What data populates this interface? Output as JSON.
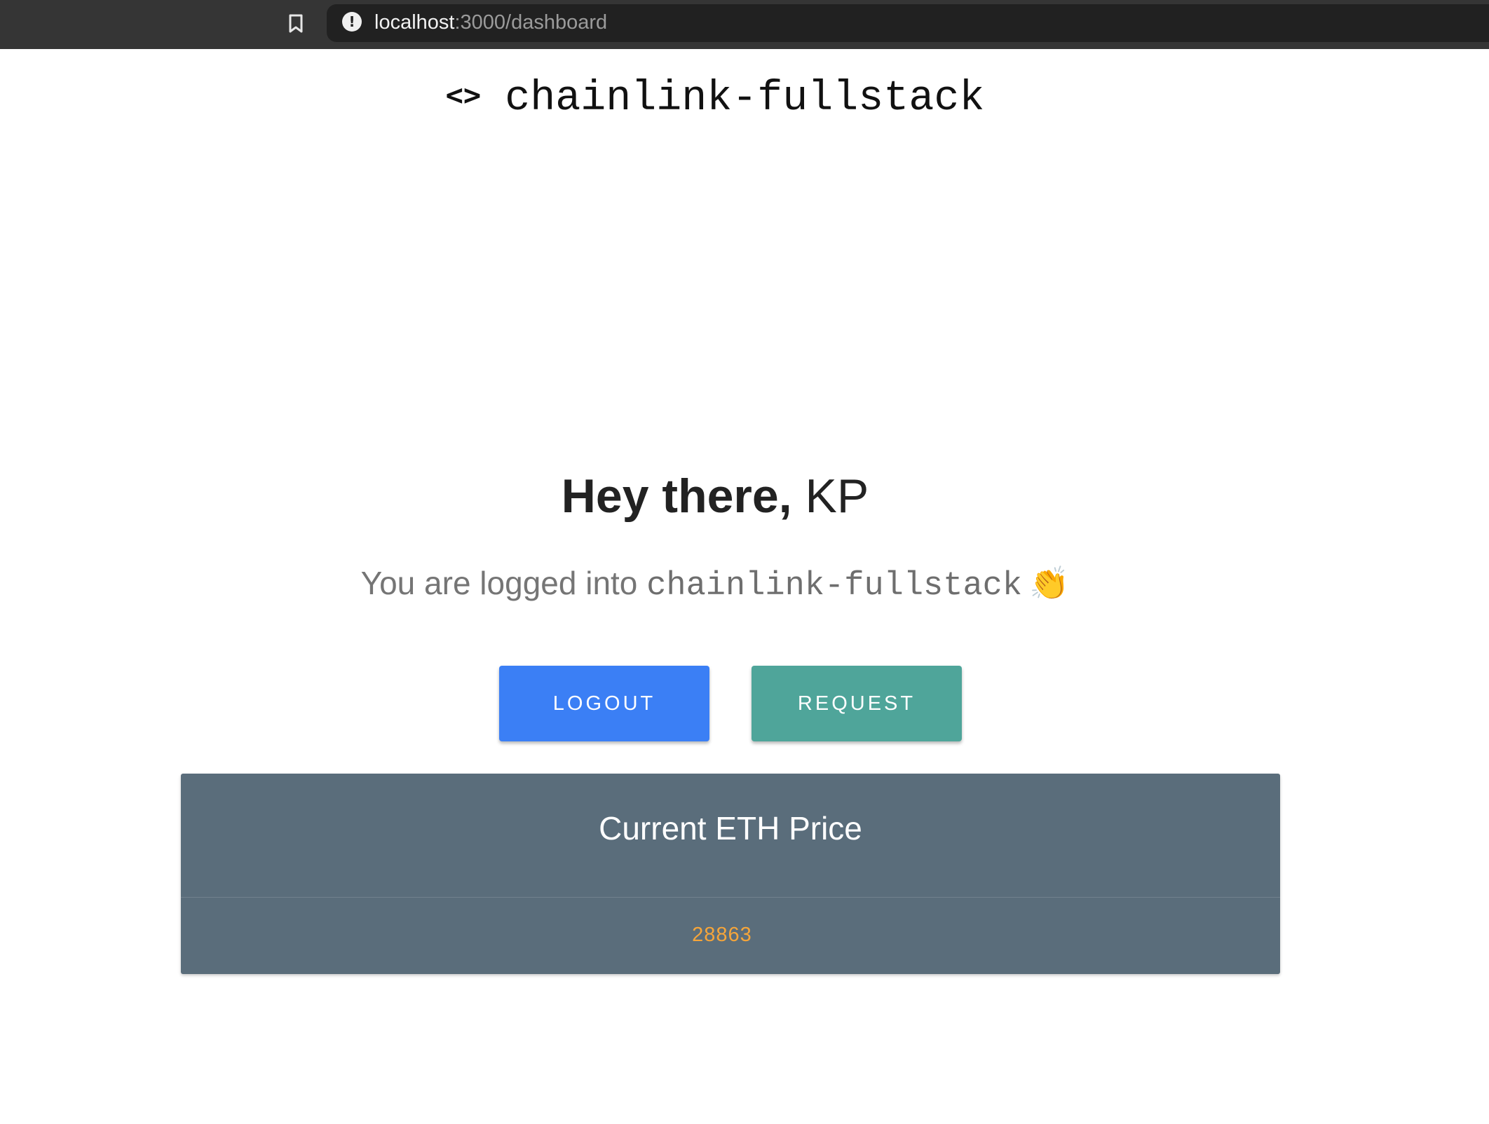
{
  "browser": {
    "url_host": "localhost",
    "url_path": ":3000/dashboard",
    "bookmark_icon": "bookmark-icon",
    "info_icon": "info-icon",
    "info_glyph": "!"
  },
  "brand": {
    "icon_glyph": "<>",
    "title": "chainlink-fullstack"
  },
  "greeting": {
    "prefix": "Hey there,",
    "name": "KP"
  },
  "subline": {
    "text": "You are logged into",
    "app_name": "chainlink-fullstack",
    "emoji": "👏"
  },
  "buttons": {
    "logout_label": "LOGOUT",
    "request_label": "REQUEST"
  },
  "price_card": {
    "title": "Current ETH Price",
    "value": "28863"
  },
  "colors": {
    "logout_button": "#3b7ff5",
    "request_button": "#4fa59a",
    "card_background": "#5a6d7b",
    "price_value": "#f5a53a"
  }
}
